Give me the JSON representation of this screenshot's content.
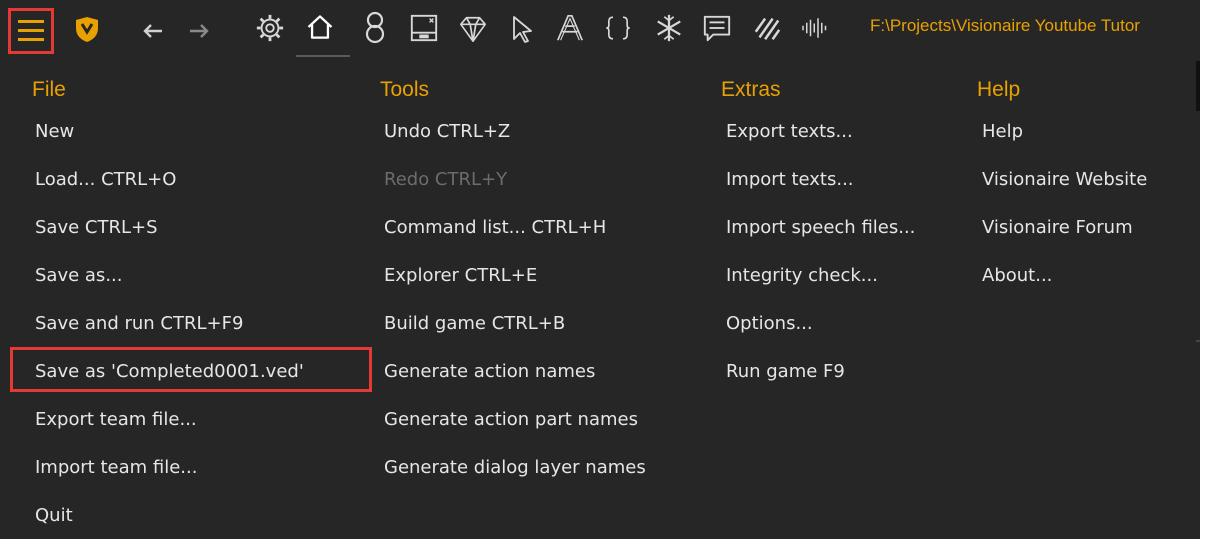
{
  "toolbar": {
    "icons": [
      "menu-icon",
      "visionaire-logo-icon",
      "back-arrow-icon",
      "forward-arrow-icon",
      "gear-icon",
      "home-icon",
      "character-icon",
      "window-icon",
      "diamond-icon",
      "cursor-icon",
      "font-icon",
      "braces-icon",
      "snowflake-icon",
      "comment-icon",
      "stripes-icon",
      "waveform-icon"
    ],
    "path": "F:\\Projects\\Visionaire Youtube Tutor"
  },
  "menu": {
    "file": {
      "title": "File",
      "items": [
        "New",
        "Load...  CTRL+O",
        "Save  CTRL+S",
        "Save as...",
        "Save and run  CTRL+F9",
        "Save as  'Completed0001.ved'",
        "Export team file...",
        "Import team file...",
        "Quit"
      ]
    },
    "tools": {
      "title": "Tools",
      "items": [
        "Undo  CTRL+Z",
        "Redo  CTRL+Y",
        "Command list...  CTRL+H",
        "Explorer  CTRL+E",
        "Build game  CTRL+B",
        "Generate action names",
        "Generate action part names",
        "Generate dialog layer names"
      ],
      "disabled_item": "Redo  CTRL+Y"
    },
    "extras": {
      "title": "Extras",
      "items": [
        "Export texts...",
        "Import texts...",
        "Import speech files...",
        "Integrity check...",
        "Options...",
        "Run game  F9"
      ]
    },
    "help": {
      "title": "Help",
      "items": [
        "Help",
        "Visionaire Website",
        "Visionaire Forum",
        "About..."
      ]
    }
  },
  "colors": {
    "background": "#262626",
    "header": "#e8a100",
    "item": "#e6e6e6",
    "disabled": "#6c6c6c",
    "highlight_border": "#e53935"
  }
}
